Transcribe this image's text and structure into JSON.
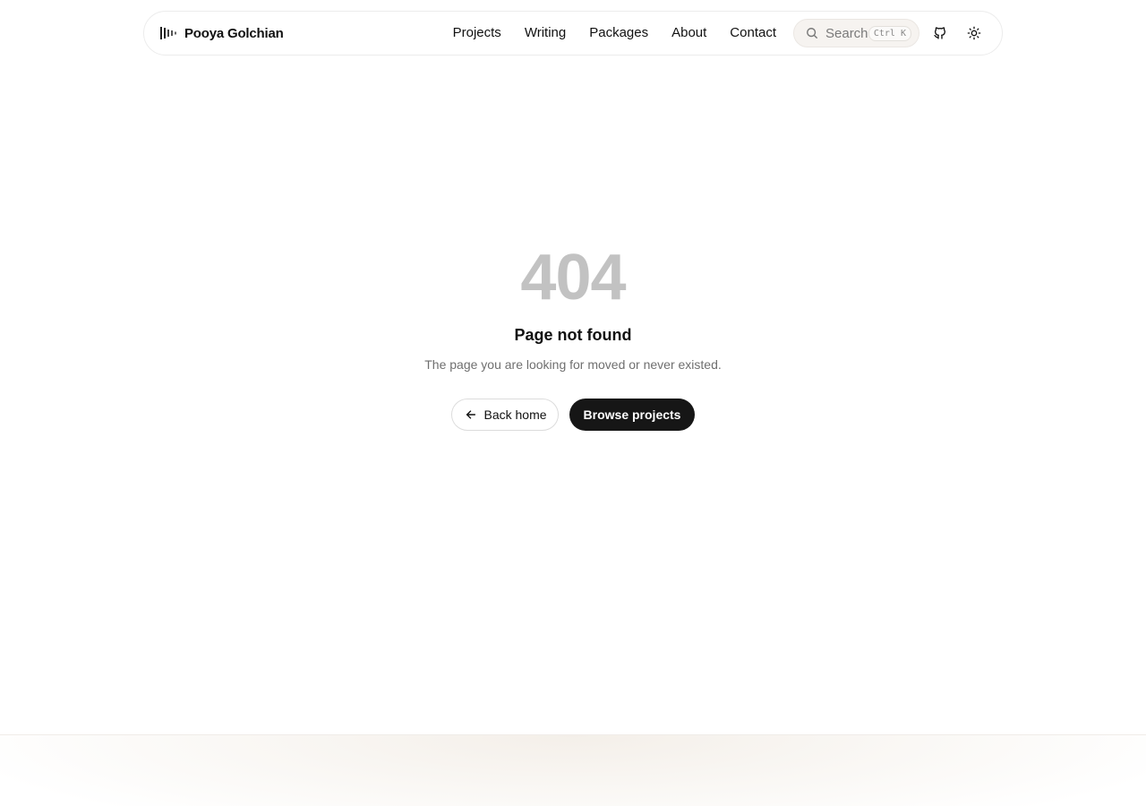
{
  "header": {
    "brand_name": "Pooya Golchian",
    "nav": [
      {
        "label": "Projects"
      },
      {
        "label": "Writing"
      },
      {
        "label": "Packages"
      },
      {
        "label": "About"
      },
      {
        "label": "Contact"
      }
    ],
    "search": {
      "label": "Search",
      "shortcut": "Ctrl K"
    },
    "icons": {
      "logo": "waveform-bars-icon",
      "search": "search-icon",
      "github": "github-icon",
      "theme": "sun-icon"
    }
  },
  "main": {
    "code": "404",
    "title": "Page not found",
    "description": "The page you are looking for moved or never existed.",
    "back_label": "Back home",
    "browse_label": "Browse projects",
    "back_icon": "arrow-left-icon"
  },
  "colors": {
    "code": "#c2c2c2",
    "primary_button": "#161616",
    "text": "#111111",
    "muted": "#6f6f6f"
  }
}
